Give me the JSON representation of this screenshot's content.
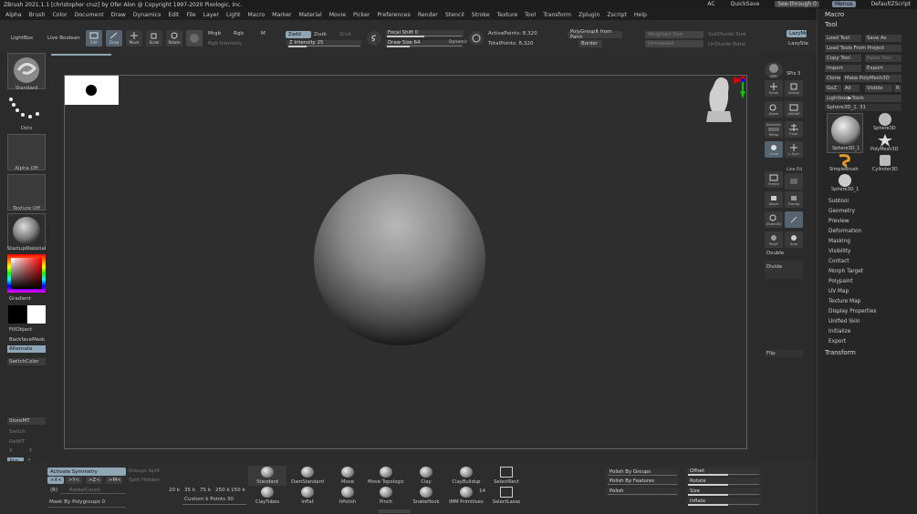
{
  "window": {
    "title": "ZBrush 2021.1.1 [christopher cruz] by Ofer Alon @ Copyright 1997-2020 Pixologic, Inc.",
    "ac": "AC",
    "quicksave": "QuickSave",
    "see_through": "See-through 0",
    "menus": "Menus",
    "default_zscript": "DefaultZScript"
  },
  "menubar": [
    "Alpha",
    "Brush",
    "Color",
    "Document",
    "Draw",
    "Dynamics",
    "Edit",
    "File",
    "Layer",
    "Light",
    "Macro",
    "Marker",
    "Material",
    "Movie",
    "Picker",
    "Preferences",
    "Render",
    "Stencil",
    "Stroke",
    "Texture",
    "Tool",
    "Transform",
    "Zplugin",
    "Zscript",
    "Help"
  ],
  "toolbar": {
    "lightbox": "LightBox",
    "live_boolean": "Live Boolean",
    "edit": "Edit",
    "draw": "Draw",
    "move": "Move",
    "scale": "Scale",
    "rotate": "Rotate",
    "mrgb": "Mrgb",
    "rgb": "Rgb",
    "m": "M",
    "rgb_intensity": "Rgb Intensity",
    "zadd": "Zadd",
    "zsub": "Zsub",
    "zcut": "Zcut",
    "z_intensity": "Z Intensity 25",
    "focal_shift": "Focal Shift 0",
    "draw_size": "Draw Size 64",
    "dynamic": "Dynamic",
    "active_points": "ActivePoints: 8,320",
    "total_points": "TotalPoints: 8,320",
    "polygroupit": "PolyGroupIt from Paint",
    "border": "Border",
    "weighted_size": "Weighted Size",
    "subdivide_size": "SubDivide Size",
    "lazymouse": "LazyMo",
    "lazystep": "LazySte",
    "unmasked": "Unmasked",
    "undivide_ratio": "UnDivide Ratio",
    "values": {
      "z_intensity": 25,
      "focal_shift": 0,
      "draw_size": 64
    }
  },
  "left_shelf": {
    "brush_label": "Standard",
    "stroke_label": "Dots",
    "alpha_label": "Alpha Off",
    "texture_label": "Texture Off",
    "material_label": "StartupMaterial",
    "gradient": "Gradient",
    "fill_object": "FillObject",
    "backface_mask": "BackfaceMask",
    "alternate": "Alternate",
    "switch_color": "SwitchColor",
    "store_mt": "StoreMT",
    "switch": "Switch",
    "del_mt": "DelMT",
    "xyz": "Xyz",
    "num_2": "2",
    "x": "X",
    "y": "Y",
    "color_main": "#000000",
    "color_secondary": "#ffffff"
  },
  "right_shelf": {
    "bpr": "BPR",
    "spix": "SPix 3",
    "scroll": "Scroll",
    "actual": "Actual",
    "zoom": "Zoom",
    "aahalf": "AAHalf",
    "dynamic": "Dynamic",
    "persp": "Persp",
    "floor": "Floor",
    "local": "Local",
    "lsym": "L.Sym",
    "line_fill": "Line Fill",
    "frame": "Frame",
    "move": "Move",
    "scale": "Scale",
    "zoom3d": "Zoom3D",
    "rotate": "Rotate",
    "polyf": "PolyF",
    "solo": "Solo",
    "double": "Double",
    "divide": "Divide",
    "flip": "Flip",
    "xpose": "Transp"
  },
  "tool_panel": {
    "macro": "Macro",
    "tool": "Tool",
    "load_tool": "Load Tool",
    "save_as": "Save As",
    "load_tools_from_project": "Load Tools From Project",
    "copy_tool": "Copy Tool",
    "paste_tool": "Paste Tool",
    "import": "Import",
    "export": "Export",
    "clone": "Clone",
    "make_polymesh3d": "Make PolyMesh3D",
    "goz": "GoZ",
    "all": "All",
    "visible": "Visible",
    "r": "R",
    "lightbox_tools": "Lightbox▶Tools",
    "current_tool": "Sphere3D_1. 31",
    "tools": [
      "Sphere3D_1",
      "Sphere3D",
      "PolyMesh3D",
      "SimpleBrush",
      "Cylinder3D",
      "Sphere3D_1"
    ],
    "subpalettes": [
      "Subtool",
      "Geometry",
      "Preview",
      "Deformation",
      "Masking",
      "Visibility",
      "Contact",
      "Morph Target",
      "Polypaint",
      "UV Map",
      "Texture Map",
      "Display Properties",
      "Unified Skin",
      "Initialize",
      "Export"
    ],
    "transform": "Transform"
  },
  "bottom": {
    "activate_symmetry": "Activate Symmetry",
    "groups_split": "Groups Split",
    "split_hidden": "Split Hidden",
    "x_axis": ">X<",
    "y_axis": ">Y<",
    "z_axis": ">Z<",
    "m_axis": ">M<",
    "r": "(R)",
    "radial_count": "RadialCount",
    "mask_by_polygroups": "Mask By Polygroups 0",
    "presets": [
      "20 k",
      "35 k",
      "75 k",
      "250 k",
      "150 k"
    ],
    "custom_points": "Custom k Points 30",
    "brushes_top": [
      "Standard",
      "DamStandard",
      "Move",
      "Move Topologic",
      "Clay",
      "ClayBuildup",
      "SelectRect"
    ],
    "brushes_bottom": [
      "ClayTubes",
      "Inflat",
      "hPolish",
      "Pinch",
      "SnakeHook",
      "IMM Primitives",
      "SelectLasso"
    ],
    "imm_count": "14",
    "polish_by_groups": "Polish By Groups",
    "polish_by_features": "Polish By Features",
    "polish": "Polish",
    "offset": "Offset",
    "rotate": "Rotate",
    "size": "Size",
    "inflate": "Inflate"
  }
}
